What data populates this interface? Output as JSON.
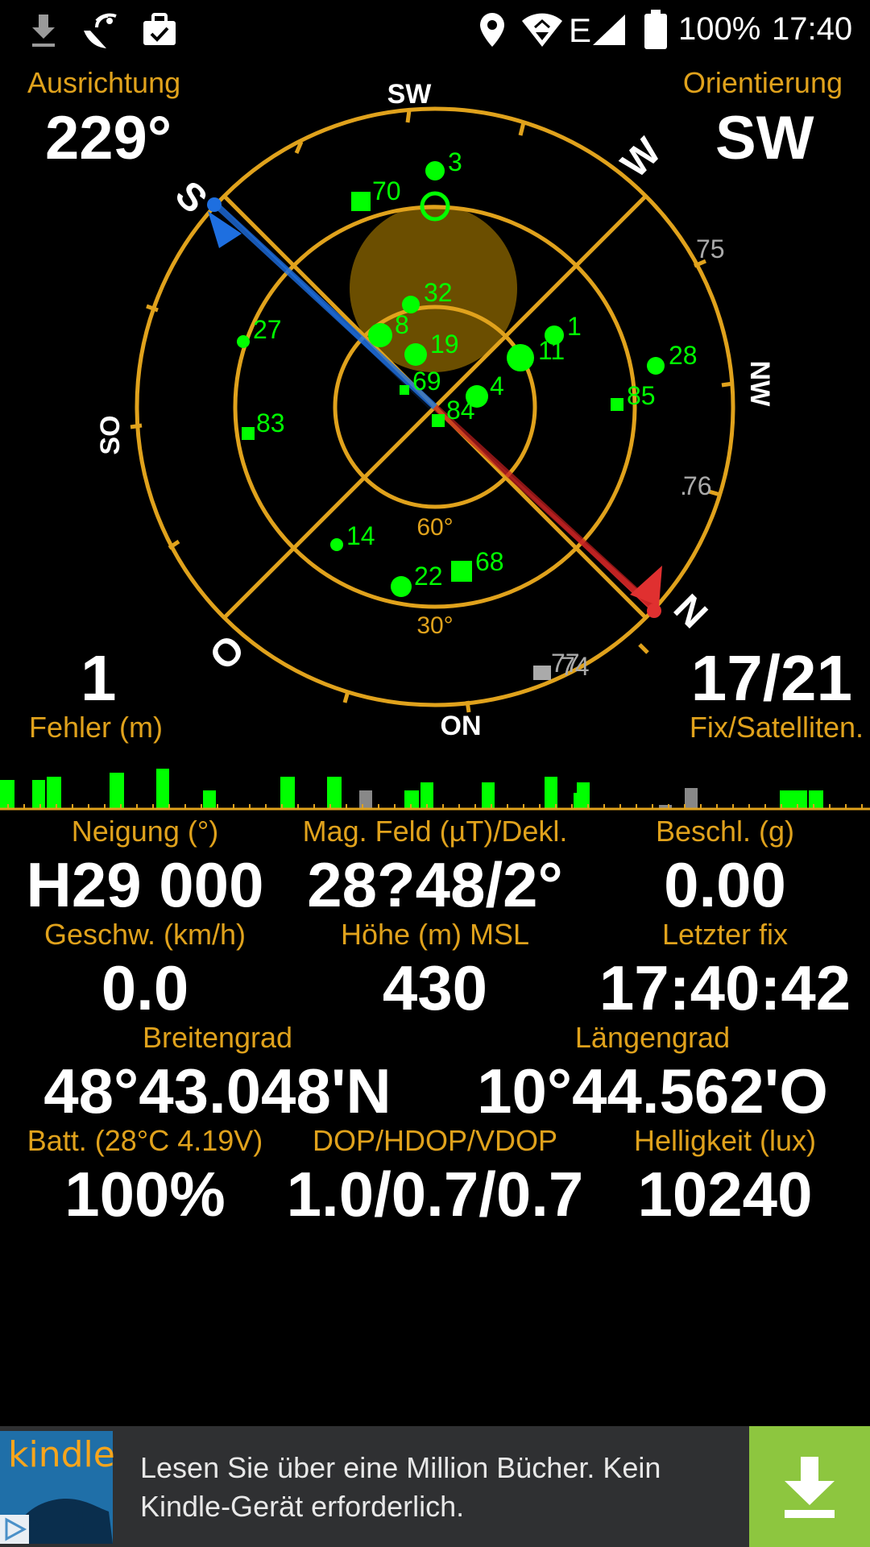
{
  "status_bar": {
    "battery_percent": "100%",
    "time": "17:40",
    "network_type": "E",
    "icons": [
      "download-icon",
      "satellite-dish-icon",
      "briefcase-check-icon",
      "location-pin-icon",
      "wifi-icon",
      "signal-icon",
      "battery-icon"
    ]
  },
  "corners": {
    "heading_label": "Ausrichtung",
    "heading_value": "229°",
    "orientation_label": "Orientierung",
    "orientation_value": "SW",
    "error_value": "1",
    "error_label": "Fehler (m)",
    "fix_value": "17/21",
    "fix_label": "Fix/Satelliten."
  },
  "compass": {
    "directions": [
      "SW",
      "W",
      "NW",
      "N",
      "ON",
      "O",
      "SO",
      "S"
    ],
    "ring_labels": [
      "60°",
      "30°"
    ],
    "satellites": [
      {
        "id": "3",
        "shape": "dot",
        "az": 0.02,
        "el": 0.72
      },
      {
        "id": "70",
        "shape": "square",
        "az": 0.13,
        "el": 0.7
      },
      {
        "id": "32",
        "shape": "dot",
        "az": 0.04,
        "el": 0.45
      },
      {
        "id": "8",
        "shape": "dot-large",
        "az": 0.09,
        "el": 0.37
      },
      {
        "id": "19",
        "shape": "dot-large",
        "az": 0.04,
        "el": 0.29
      },
      {
        "id": "27",
        "shape": "dot",
        "az": 0.2,
        "el": 0.49
      },
      {
        "id": "1",
        "shape": "dot",
        "az": 0.8,
        "el": 0.53
      },
      {
        "id": "11",
        "shape": "dot-large",
        "az": 0.77,
        "el": 0.45
      },
      {
        "id": "28",
        "shape": "dot",
        "az": 0.72,
        "el": 0.65
      },
      {
        "id": "85",
        "shape": "square",
        "az": 0.71,
        "el": 0.55
      },
      {
        "id": "4",
        "shape": "dot-large",
        "az": 0.69,
        "el": 0.15
      },
      {
        "id": "69",
        "shape": "square",
        "az": 0.02,
        "el": 0.1
      },
      {
        "id": "84",
        "shape": "square",
        "az": 0.5,
        "el": 0.02
      },
      {
        "id": "83",
        "shape": "square",
        "az": 0.25,
        "el": 0.6
      },
      {
        "id": "14",
        "shape": "dot",
        "az": 0.36,
        "el": 0.55
      },
      {
        "id": "22",
        "shape": "dot-large",
        "az": 0.45,
        "el": 0.67
      },
      {
        "id": "68",
        "shape": "square",
        "az": 0.48,
        "el": 0.64
      },
      {
        "id": "75",
        "shape": "gray-text",
        "az": 0.63,
        "el": 0.97
      },
      {
        "id": "76",
        "shape": "gray-text",
        "az": 0.74,
        "el": 0.97
      },
      {
        "id": "77",
        "shape": "gray-square",
        "az": 0.43,
        "el": 0.97
      },
      {
        "id": "74",
        "shape": "gray-text",
        "az": 0.43,
        "el": 0.97
      }
    ],
    "sun_icon": "sun-disc-icon"
  },
  "signal_bars": [
    {
      "value": 0.55,
      "color": "#00ff00"
    },
    {
      "value": 0.55,
      "color": "#00ff00"
    },
    {
      "value": 0.6,
      "color": "#00ff00"
    },
    {
      "value": 0.68,
      "color": "#00ff00"
    },
    {
      "value": 0.75,
      "color": "#00ff00"
    },
    {
      "value": 0.35,
      "color": "#00ff00"
    },
    {
      "value": 0.6,
      "color": "#00ff00"
    },
    {
      "value": 0.6,
      "color": "#00ff00"
    },
    {
      "value": 0.35,
      "color": "#888888"
    },
    {
      "value": 0.35,
      "color": "#00ff00"
    },
    {
      "value": 0.5,
      "color": "#00ff00"
    },
    {
      "value": 0.5,
      "color": "#00ff00"
    },
    {
      "value": 0.6,
      "color": "#00ff00"
    },
    {
      "value": 0.3,
      "color": "#00ff00"
    },
    {
      "value": 0.5,
      "color": "#00ff00"
    },
    {
      "value": 0.08,
      "color": "#888888"
    },
    {
      "value": 0.4,
      "color": "#888888"
    },
    {
      "value": 0.35,
      "color": "#00ff00"
    },
    {
      "value": 0.35,
      "color": "#00ff00"
    },
    {
      "value": 0.35,
      "color": "#00ff00"
    }
  ],
  "stats": {
    "tilt_label": "Neigung (°)",
    "tilt_value": "H29 000",
    "mag_label": "Mag. Feld (µT)/Dekl.",
    "mag_value": "28?48/2°",
    "accel_label": "Beschl. (g)",
    "accel_value": "0.00",
    "speed_label": "Geschw. (km/h)",
    "speed_value": "0.0",
    "alt_label": "Höhe (m) MSL",
    "alt_value": "430",
    "lastfix_label": "Letzter fix",
    "lastfix_value": "17:40:42",
    "lat_label": "Breitengrad",
    "lat_value": "48°43.048'N",
    "lon_label": "Längengrad",
    "lon_value": "10°44.562'O",
    "batt_label": "Batt. (28°C 4.19V)",
    "batt_value": "100%",
    "dop_label": "DOP/HDOP/VDOP",
    "dop_value": "1.0/0.7/0.7",
    "lux_label": "Helligkeit (lux)",
    "lux_value": "10240"
  },
  "ad": {
    "logo_text": "kindle",
    "text_line1": "Lesen Sie über eine Million Bücher. Kein",
    "text_line2": "Kindle-Gerät erforderlich.",
    "download_icon": "download-arrow-icon",
    "adchoices_icon": "ad-choices-icon"
  },
  "colors": {
    "accent": "#e0a21c",
    "satellite": "#00ff00",
    "needle_south": "#1e6fe0",
    "needle_north": "#e03030",
    "ad_button": "#8dc63f"
  }
}
